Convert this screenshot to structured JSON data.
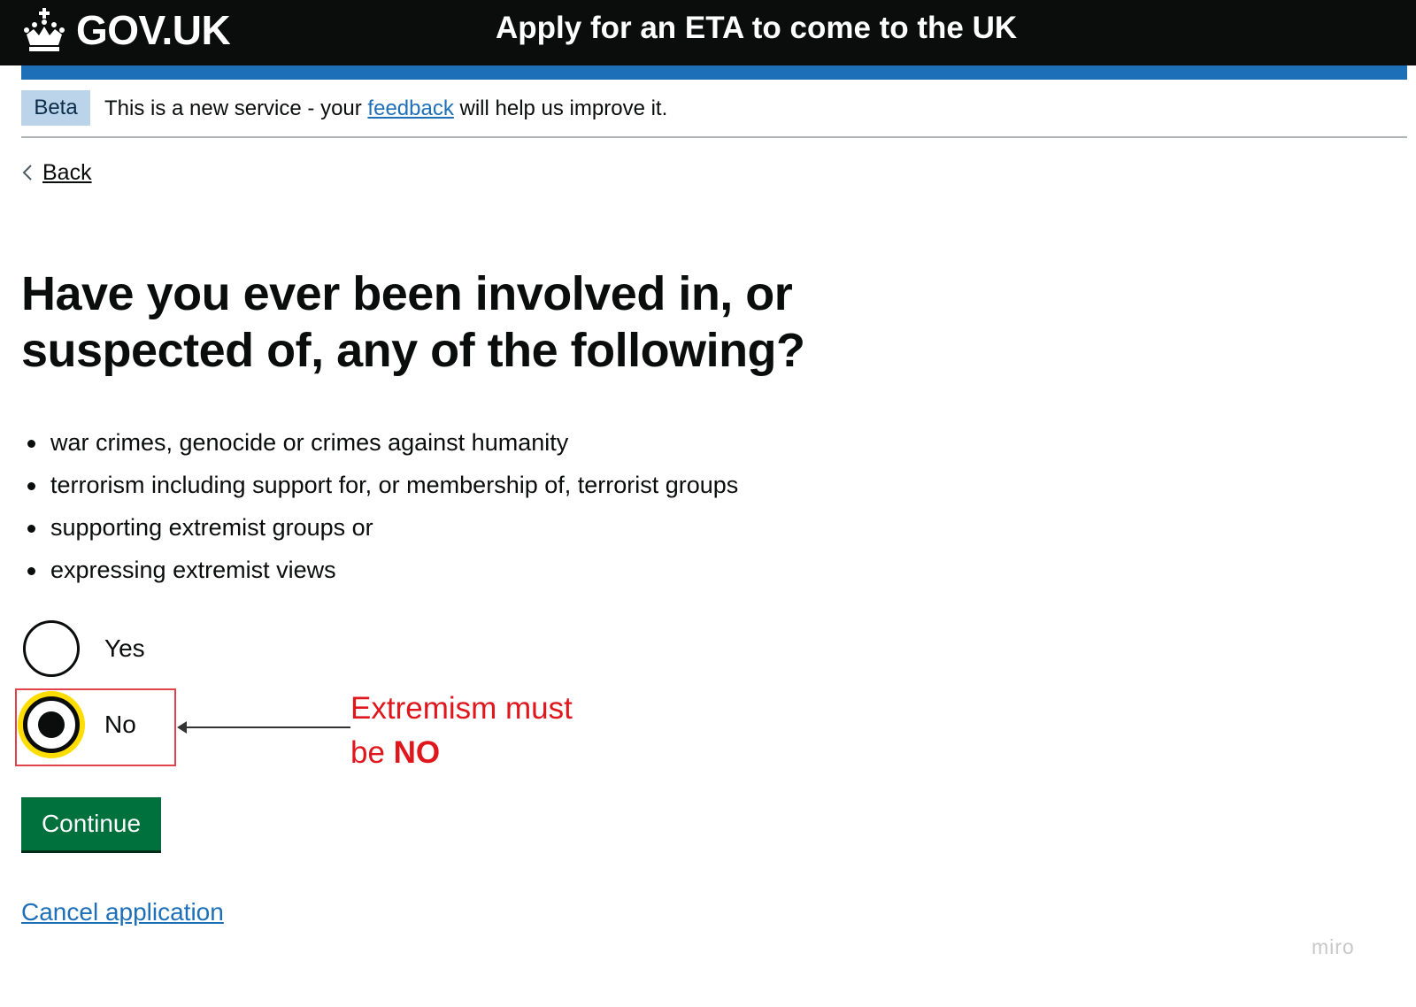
{
  "header": {
    "logo_text": "GOV.UK",
    "service_name": "Apply for an ETA to come to the UK"
  },
  "phase_banner": {
    "tag": "Beta",
    "text_before": "This is a new service - your ",
    "link_text": "feedback",
    "text_after": " will help us improve it."
  },
  "back_link": "Back",
  "question": {
    "heading": "Have you ever been involved in, or suspected of, any of the following?",
    "items": [
      "war crimes, genocide or crimes against humanity",
      "terrorism including support for, or membership of, terrorist groups",
      "supporting extremist groups or",
      "expressing extremist views"
    ]
  },
  "radios": {
    "options": [
      {
        "label": "Yes",
        "checked": false
      },
      {
        "label": "No",
        "checked": true
      }
    ]
  },
  "annotation": {
    "line1": "Extremism must",
    "line2_prefix": "be ",
    "line2_strong": "NO",
    "color": "#e0161d"
  },
  "continue_label": "Continue",
  "cancel_label": "Cancel application",
  "watermark": "miro",
  "colors": {
    "header_bg": "#0b0c0c",
    "accent_blue": "#1d70b8",
    "button_green": "#00703c",
    "focus_yellow": "#ffdd00"
  }
}
